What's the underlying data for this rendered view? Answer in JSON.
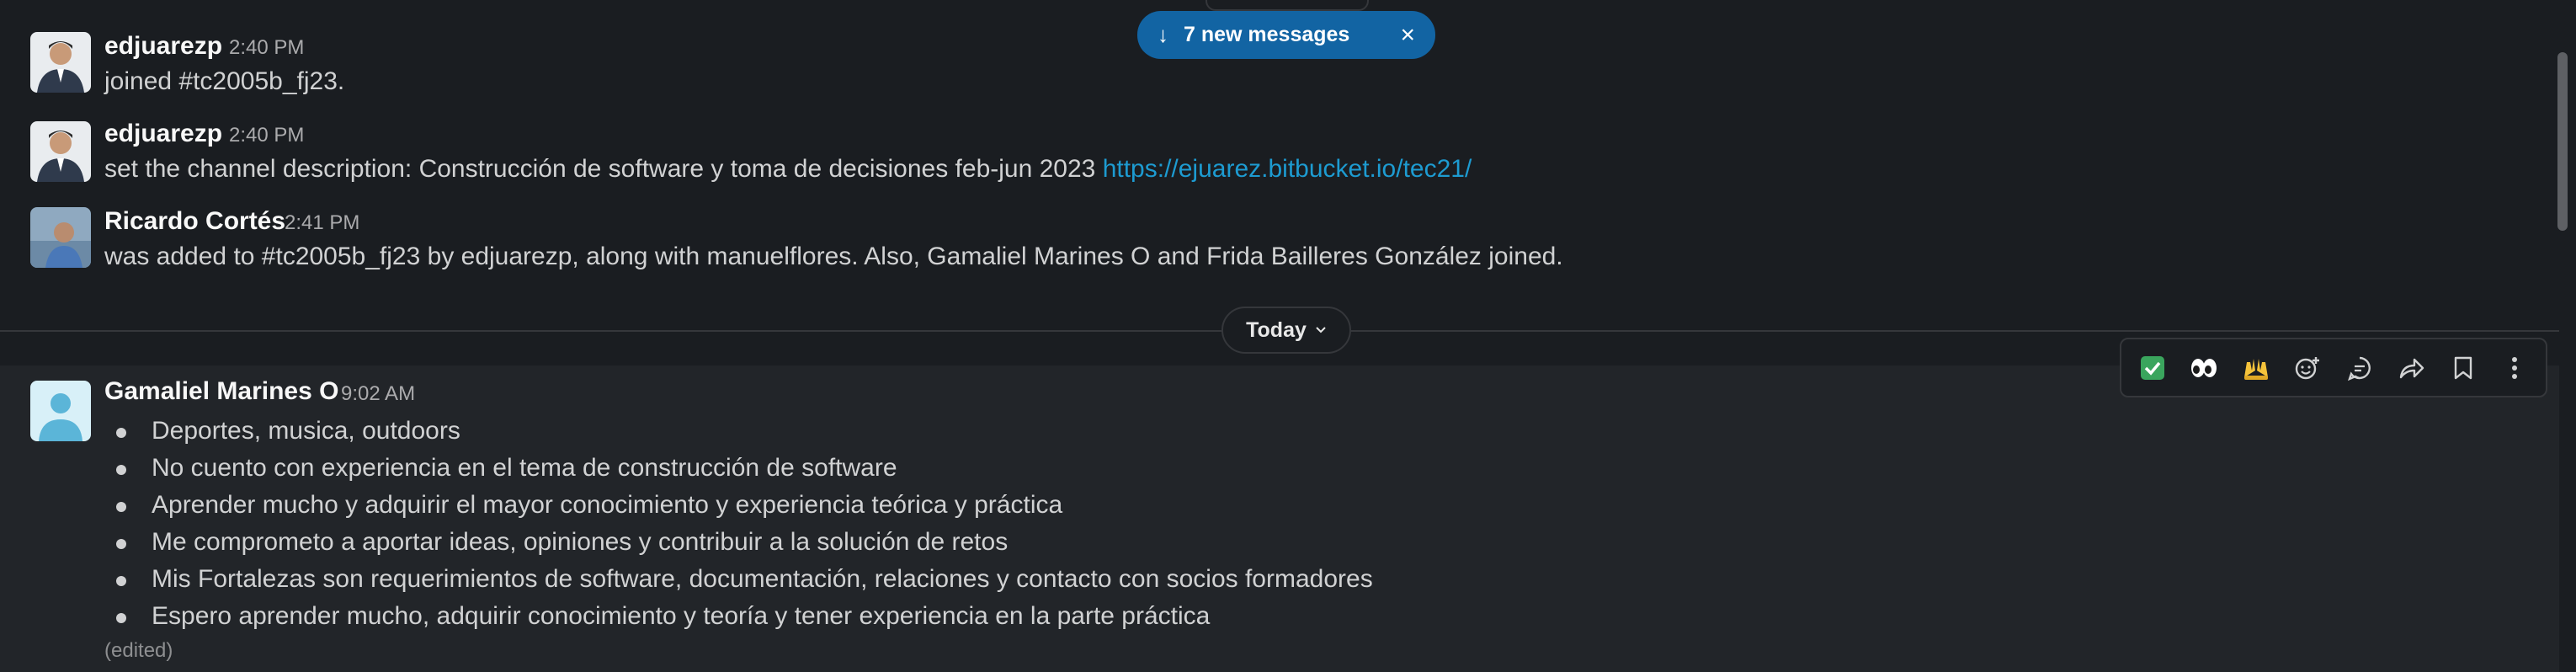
{
  "toast": {
    "label": "7 new messages",
    "arrow": "↓",
    "close": "×"
  },
  "messages": [
    {
      "author": "edjuarezp",
      "time": "2:40 PM",
      "text": "joined #tc2005b_fj23.",
      "avatar": "photo-avatar"
    },
    {
      "author": "edjuarezp",
      "time": "2:40 PM",
      "text": "set the channel description: Construcción de software y toma de decisiones feb-jun 2023 ",
      "link": "https://ejuarez.bitbucket.io/tec21/",
      "avatar": "photo-avatar"
    },
    {
      "author": "Ricardo Cortés",
      "time": "2:41 PM",
      "text": "was added to #tc2005b_fj23 by edjuarezp, along with manuelflores. Also, Gamaliel Marines O and Frida Bailleres González joined.",
      "avatar": "photo-avatar"
    }
  ],
  "divider": {
    "label": "Today",
    "icon": "chevron-down-icon"
  },
  "main_message": {
    "author": "Gamaliel Marines O",
    "time": "9:02 AM",
    "bullets": [
      "Deportes, musica, outdoors",
      "No cuento con experiencia en el tema de construcción de software",
      "Aprender mucho y adquirir el mayor conocimiento y experiencia teórica y práctica",
      "Me comprometo a aportar ideas, opiniones y contribuir a la solución de retos",
      "Mis Fortalezas son requerimientos de software, documentación, relaciones y contacto con socios formadores",
      "Espero aprender mucho, adquirir conocimiento y teoría y tener experiencia en la parte práctica"
    ],
    "edited": "(edited)",
    "avatar": "default-user-avatar"
  },
  "actions": [
    {
      "name": "check-mark-reaction",
      "glyph": "✅"
    },
    {
      "name": "eyes-reaction",
      "glyph": "👀"
    },
    {
      "name": "raised-hands-reaction",
      "glyph": "🙌"
    },
    {
      "name": "add-reaction-icon",
      "glyph": "☺"
    },
    {
      "name": "reply-in-thread-icon",
      "glyph": "💬"
    },
    {
      "name": "forward-icon",
      "glyph": "↪"
    },
    {
      "name": "save-bookmark-icon",
      "glyph": "🔖"
    },
    {
      "name": "more-actions-icon",
      "glyph": "⋮"
    }
  ],
  "colors": {
    "background": "#1a1d21",
    "accent": "#1264a3",
    "link": "#1d9bd1"
  }
}
